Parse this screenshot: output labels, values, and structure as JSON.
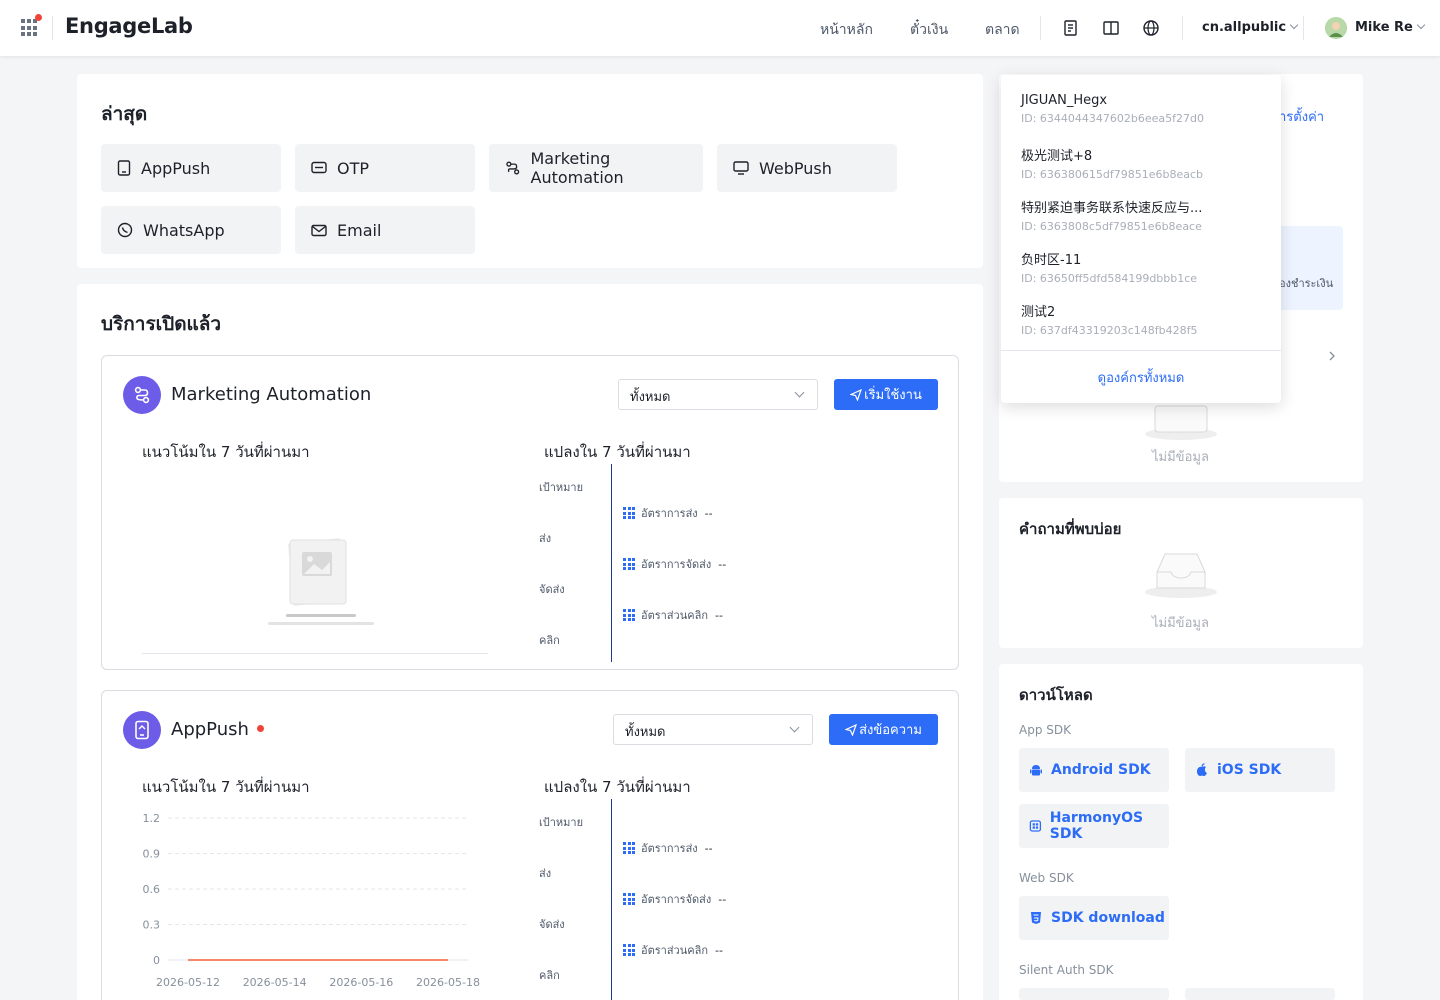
{
  "header": {
    "logo": "EngageLab",
    "nav": [
      "หน้าหลัก",
      "ตั๋วเงิน",
      "ตลาด"
    ],
    "org": "cn.allpublic",
    "user": "Mike Re"
  },
  "recent": {
    "title": "ล่าสุด",
    "items": [
      "AppPush",
      "OTP",
      "Marketing Automation",
      "WebPush",
      "WhatsApp",
      "Email"
    ]
  },
  "services": {
    "title": "บริการเปิดแล้ว",
    "cards": [
      {
        "name": "Marketing Automation",
        "filter": "ทั้งหมด",
        "action": "เริ่มใช้งาน",
        "trend_title": "แนวโน้มใน 7 วันที่ผ่านมา",
        "conv_title": "แปลงใน 7 วันที่ผ่านมา",
        "funnel": [
          "เป้าหมาย",
          "ส่ง",
          "จัดส่ง",
          "คลิก"
        ],
        "rates": [
          "อัตราการส่ง",
          "อัตราการจัดส่ง",
          "อัตราส่วนคลิก"
        ],
        "rate_value": "--"
      },
      {
        "name": "AppPush",
        "filter": "ทั้งหมด",
        "action": "ส่งข้อความ",
        "trend_title": "แนวโน้มใน 7 วันที่ผ่านมา",
        "conv_title": "แปลงใน 7 วันที่ผ่านมา",
        "funnel": [
          "เป้าหมาย",
          "ส่ง",
          "จัดส่ง",
          "คลิก"
        ],
        "rates": [
          "อัตราการส่ง",
          "อัตราการจัดส่ง",
          "อัตราส่วนคลิก"
        ],
        "rate_value": "--"
      }
    ]
  },
  "chart_data": {
    "type": "line",
    "x": [
      "2026-05-12",
      "2026-05-13",
      "2026-05-14",
      "2026-05-15",
      "2026-05-16",
      "2026-05-17",
      "2026-05-18"
    ],
    "x_tick_labels": [
      "2026-05-12",
      "2026-05-14",
      "2026-05-16",
      "2026-05-18"
    ],
    "y_ticks": [
      "1.2",
      "0.9",
      "0.6",
      "0.3",
      "0"
    ],
    "ylim": [
      0,
      1.2
    ],
    "series": [
      {
        "values": [
          0,
          0,
          0,
          0,
          0,
          0,
          0
        ],
        "color": "#f5603b"
      }
    ],
    "grid": true
  },
  "org_dropdown": {
    "items": [
      {
        "name": "JIGUAN_Hegx",
        "id": "ID: 6344044347602b6eea5f27d0"
      },
      {
        "name": "极光测试+8",
        "id": "ID: 636380615df79851e6b8eacb"
      },
      {
        "name": "特别紧迫事务联系快速反应与...",
        "id": "ID: 6363808c5df79851e6b8eace"
      },
      {
        "name": "负时区-11",
        "id": "ID: 63650ff5dfd584199dbbb1ce"
      },
      {
        "name": "测试2",
        "id": "ID: 637df43319203c148fb428f5"
      }
    ],
    "view_all": "ดูองค์กรทั้งหมด"
  },
  "right": {
    "settings_link": "ารตั้งค่า",
    "pending_text": "้องชำระเงิน",
    "empty": "ไม่มีข้อมูล",
    "faq_title": "คำถามที่พบบ่อย",
    "download_title": "ดาวน์โหลด",
    "groups": [
      {
        "label": "App SDK",
        "buttons": [
          "Android SDK",
          "iOS SDK",
          "HarmonyOS SDK"
        ]
      },
      {
        "label": "Web SDK",
        "buttons": [
          "SDK download"
        ]
      },
      {
        "label": "Silent Auth SDK",
        "buttons": []
      }
    ]
  },
  "colors": {
    "primary": "#2d6cf6",
    "brand_purple": "#6c5ce7",
    "alert": "#f04438"
  }
}
